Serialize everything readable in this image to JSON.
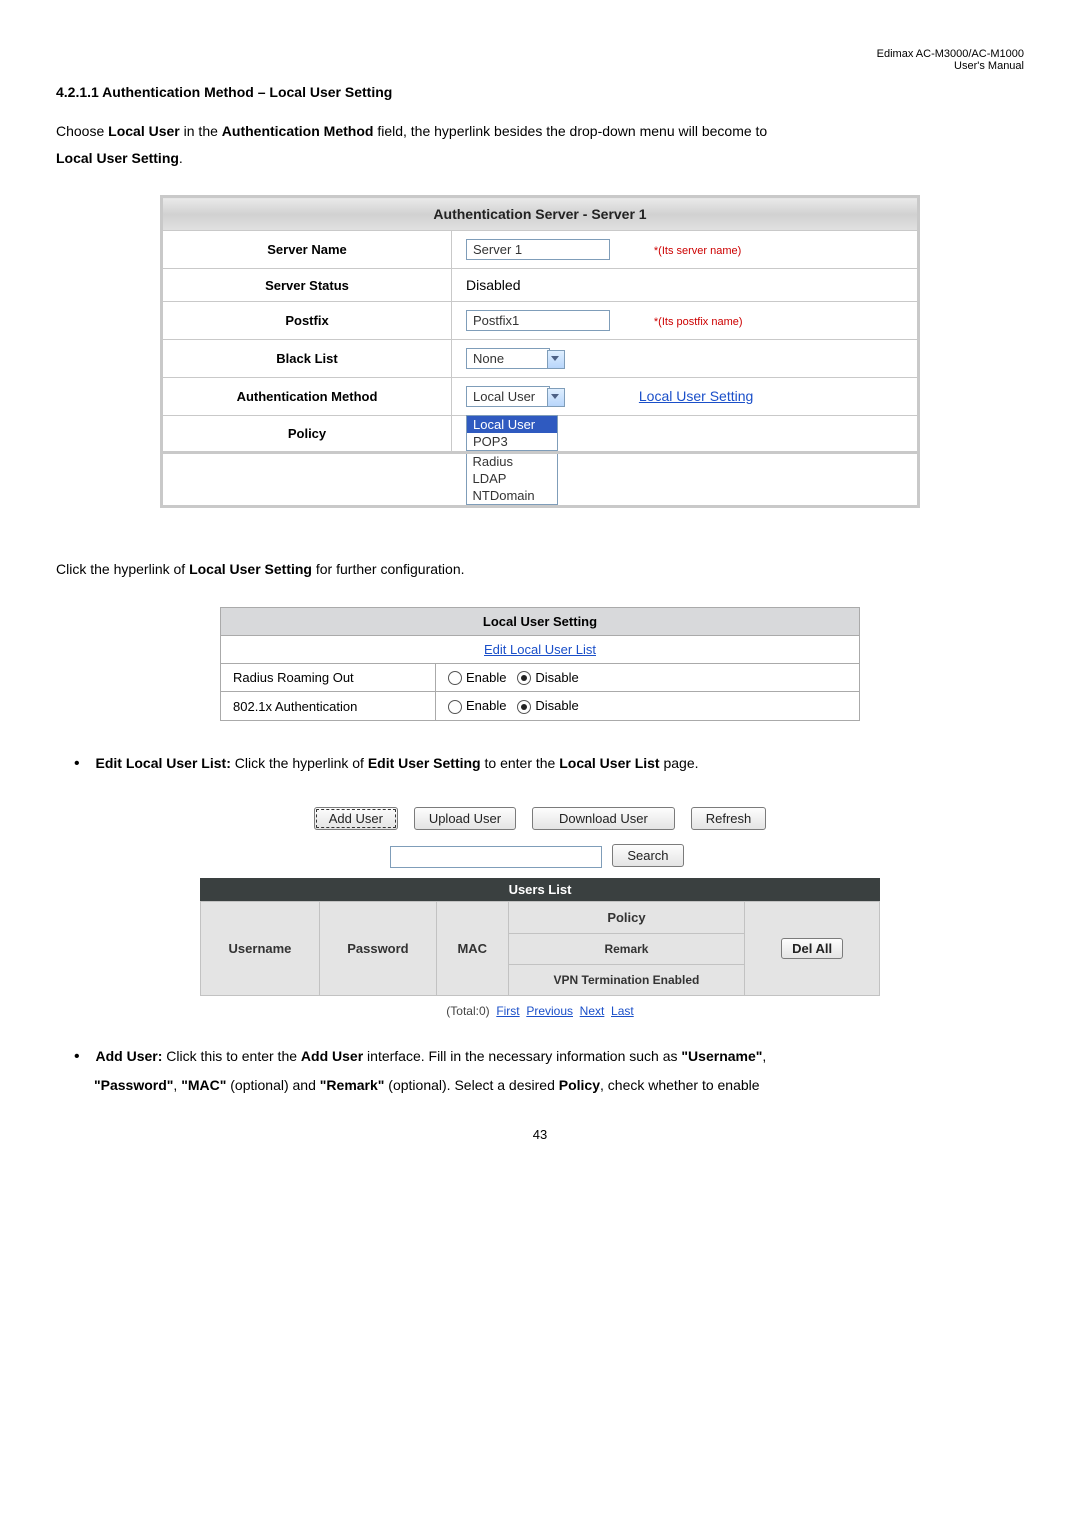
{
  "header": {
    "product": "Edimax  AC-M3000/AC-M1000",
    "subtitle": "User's  Manual"
  },
  "section_number": "4.2.1.1  Authentication Method – Local User Setting",
  "intro": {
    "before_local_user": "Choose ",
    "local_user": "Local User",
    "between1": " in the ",
    "auth_method": "Authentication Method",
    "between2": " field, the hyperlink besides the drop-down menu will become to ",
    "local_user_setting": "Local User Setting",
    "after": "."
  },
  "auth_table": {
    "heading": "Authentication Server - Server 1",
    "rows": {
      "server_name": {
        "label": "Server Name",
        "value": "Server 1",
        "hint": "*(Its server name)"
      },
      "server_status": {
        "label": "Server Status",
        "value": "Disabled"
      },
      "postfix": {
        "label": "Postfix",
        "value": "Postfix1",
        "hint": "*(Its postfix name)"
      },
      "black_list": {
        "label": "Black List",
        "value": "None"
      },
      "auth_method": {
        "label": "Authentication Method",
        "value": "Local User",
        "link": "Local User Setting"
      },
      "policy": {
        "label": "Policy"
      }
    },
    "dropdown_options": [
      "Local User",
      "POP3",
      "Radius",
      "LDAP",
      "NTDomain"
    ]
  },
  "click_hyperlink_sentence": {
    "before": "Click the hyperlink of ",
    "bold": "Local User Setting",
    "after": " for further configuration."
  },
  "local_table": {
    "heading": "Local User Setting",
    "edit_link": "Edit Local User List",
    "rows": [
      {
        "label": "Radius Roaming Out",
        "enable": "Enable",
        "disable": "Disable"
      },
      {
        "label": "802.1x Authentication",
        "enable": "Enable",
        "disable": "Disable"
      }
    ]
  },
  "bullets": {
    "edit_local": {
      "lead": "Edit Local User List:",
      "before_edit": " Click the hyperlink of ",
      "edit_user_setting": "Edit User Setting",
      "between": " to enter the ",
      "local_user_list": "Local User List",
      "after": " page."
    },
    "add_user": {
      "lead": "Add User:",
      "before": " Click this to enter the ",
      "add_user": "Add User",
      "mid1": " interface. Fill in the necessary information such as ",
      "username_q": "\"Username\"",
      "comma1": ", ",
      "password_q": "\"Password\"",
      "comma2": ", ",
      "mac_q": "\"MAC\"",
      "opt1": " (optional) and ",
      "remark_q": "\"Remark\"",
      "opt2": " (optional). Select a desired ",
      "policy": "Policy",
      "after": ", check whether to enable"
    }
  },
  "buttons": {
    "add_user": "Add User",
    "upload_user": "Upload User",
    "download_user": "Download User",
    "refresh": "Refresh",
    "search": "Search",
    "del_all": "Del All"
  },
  "users_list": {
    "bar": "Users List",
    "col_username": "Username",
    "col_password": "Password",
    "col_mac": "MAC",
    "col_policy": "Policy",
    "col_remark": "Remark",
    "col_vpn": "VPN Termination Enabled"
  },
  "pager": {
    "total": "(Total:0)",
    "first": "First",
    "previous": "Previous",
    "next": "Next",
    "last": "Last"
  },
  "pagenum": "43"
}
